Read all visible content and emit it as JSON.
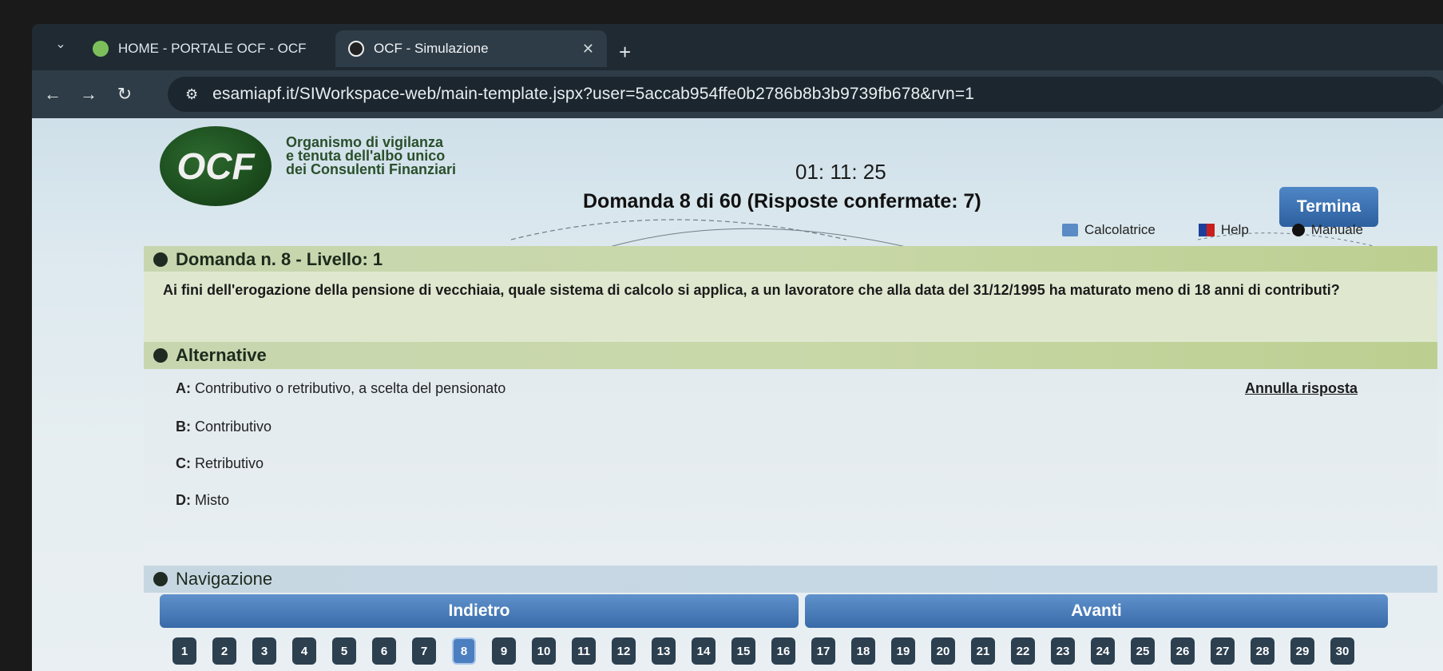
{
  "browser": {
    "tabs": [
      {
        "label": "HOME - PORTALE OCF - OCF"
      },
      {
        "label": "OCF - Simulazione"
      }
    ],
    "new_tab": "+",
    "close": "✕",
    "url": "esamiapf.it/SIWorkspace-web/main-template.jspx?user=5accab954ffe0b2786b8b3b9739fb678&rvn=1"
  },
  "header": {
    "logo_text": "OCF",
    "org_lines": [
      "Organismo di vigilanza",
      "e tenuta dell'albo unico",
      "dei Consulenti Finanziari"
    ],
    "timer": "01: 11: 25",
    "termina": "Termina",
    "progress": "Domanda 8 di 60 (Risposte confermate: 7)",
    "tools": {
      "calc": "Calcolatrice",
      "help": "Help",
      "manual": "Manuale"
    }
  },
  "question": {
    "title": "Domanda n. 8 - Livello: 1",
    "text": "Ai fini dell'erogazione della pensione di vecchiaia, quale sistema di calcolo si applica, a un lavoratore che alla data del 31/12/1995 ha maturato meno di 18 anni di contributi?"
  },
  "answers": {
    "title": "Alternative",
    "annulla": "Annulla risposta",
    "items": [
      {
        "key": "A:",
        "text": "Contributivo o retributivo, a scelta del pensionato"
      },
      {
        "key": "B:",
        "text": "Contributivo"
      },
      {
        "key": "C:",
        "text": "Retributivo"
      },
      {
        "key": "D:",
        "text": "Misto"
      }
    ]
  },
  "navigation": {
    "title": "Navigazione",
    "back": "Indietro",
    "next": "Avanti",
    "current": 8,
    "numbers": [
      "1",
      "2",
      "3",
      "4",
      "5",
      "6",
      "7",
      "8",
      "9",
      "10",
      "11",
      "12",
      "13",
      "14",
      "15",
      "16",
      "17",
      "18",
      "19",
      "20",
      "21",
      "22",
      "23",
      "24",
      "25",
      "26",
      "27",
      "28",
      "29",
      "30"
    ]
  }
}
